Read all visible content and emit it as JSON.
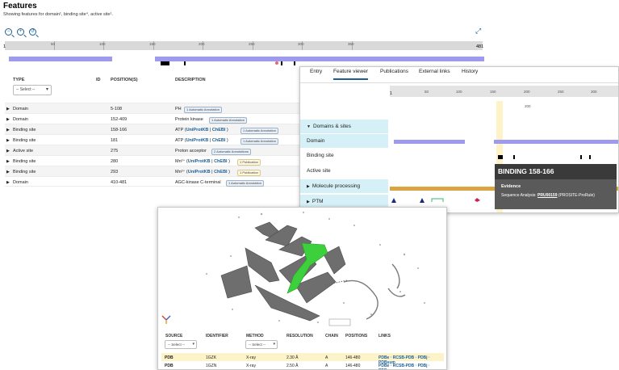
{
  "features": {
    "title": "Features",
    "subtitle": "Showing features for domain¹, binding site⁴, active site¹.",
    "ruler": {
      "start": "1",
      "end": "481",
      "ticks": [
        "50",
        "100",
        "150",
        "200",
        "250",
        "300",
        "350"
      ]
    },
    "table": {
      "headers": {
        "type": "TYPE",
        "id": "ID",
        "positions": "POSITION(S)",
        "description": "DESCRIPTION"
      },
      "type_select": "-- Select --",
      "rows": [
        {
          "type": "Domain",
          "positions": "5-108",
          "description": "PH",
          "badge": "1 Automatic Annotation"
        },
        {
          "type": "Domain",
          "positions": "152-409",
          "description": "Protein kinase",
          "badge": "1 Automatic Annotation"
        },
        {
          "type": "Binding site",
          "positions": "158-166",
          "description": "ATP (",
          "link1": "UniProtKB",
          "sep": " | ",
          "link2": "ChEBI",
          "after": " )",
          "badge": "1 Automatic Annotation"
        },
        {
          "type": "Binding site",
          "positions": "181",
          "description": "ATP (",
          "link1": "UniProtKB",
          "sep": " | ",
          "link2": "ChEBI",
          "after": " )",
          "badge": "1 Automatic Annotation"
        },
        {
          "type": "Active site",
          "positions": "275",
          "description": "Proton acceptor",
          "badge": "2 Automatic Annotations"
        },
        {
          "type": "Binding site",
          "positions": "280",
          "description": "Mn²⁺ (",
          "link1": "UniProtKB",
          "sep": " | ",
          "link2": "ChEBI",
          "after": " )",
          "badge": "1 Publication"
        },
        {
          "type": "Binding site",
          "positions": "293",
          "description": "Mn²⁺ (",
          "link1": "UniProtKB",
          "sep": " | ",
          "link2": "ChEBI",
          "after": " )",
          "badge": "1 Publication"
        },
        {
          "type": "Domain",
          "positions": "410-481",
          "description": "AGC-kinase C-terminal",
          "badge": "1 Automatic Annotation"
        }
      ]
    }
  },
  "viewer": {
    "tabs": [
      "Entry",
      "Feature viewer",
      "Publications",
      "External links",
      "History"
    ],
    "active_tab": "Feature viewer",
    "ruler_start": "1",
    "ruler_ticks": [
      "50",
      "100",
      "150",
      "200",
      "250",
      "300"
    ],
    "inner_tick": "200",
    "categories": [
      {
        "label": "Domains & sites",
        "kind": "category",
        "expanded": true
      },
      {
        "label": "Domain",
        "kind": "track"
      },
      {
        "label": "Binding site",
        "kind": "track"
      },
      {
        "label": "Active site",
        "kind": "track"
      },
      {
        "label": "Molecule processing",
        "kind": "category",
        "expanded": false
      },
      {
        "label": "PTM",
        "kind": "category",
        "expanded": false
      }
    ],
    "tooltip": {
      "title": "BINDING 158-166",
      "evidence_label": "Evidence",
      "source_prefix": "Sequence Analysis: ",
      "source_link": "PRU00159",
      "source_suffix": " (PROSITE-ProRule)"
    }
  },
  "structure": {
    "headers": {
      "source": "SOURCE",
      "identifier": "IDENTIFIER",
      "method": "METHOD",
      "resolution": "RESOLUTION",
      "chain": "CHAIN",
      "positions": "POSITIONS",
      "links": "LINKS"
    },
    "source_select": "-- Select --",
    "method_select": "-- Select --",
    "rows": [
      {
        "source": "PDB",
        "identifier": "1GZK",
        "method": "X-ray",
        "resolution": "2.30 Å",
        "chain": "A",
        "positions": "146-480",
        "links": "PDBe · RCSB-PDB · PDBj · PDBsum",
        "selected": true
      },
      {
        "source": "PDB",
        "identifier": "1GZN",
        "method": "X-ray",
        "resolution": "2.50 Å",
        "chain": "A",
        "positions": "146-480",
        "links": "PDBe · RCSB-PDB · PDBj · PDBsum",
        "selected": false
      }
    ]
  },
  "colors": {
    "accent": "#1c5f96",
    "track": "#9e9bef",
    "category_bg": "#d6f0f7",
    "highlight": "#fdf3c6",
    "binding_helix": "#3dd03d",
    "ribbon": "#7a7a7a"
  }
}
